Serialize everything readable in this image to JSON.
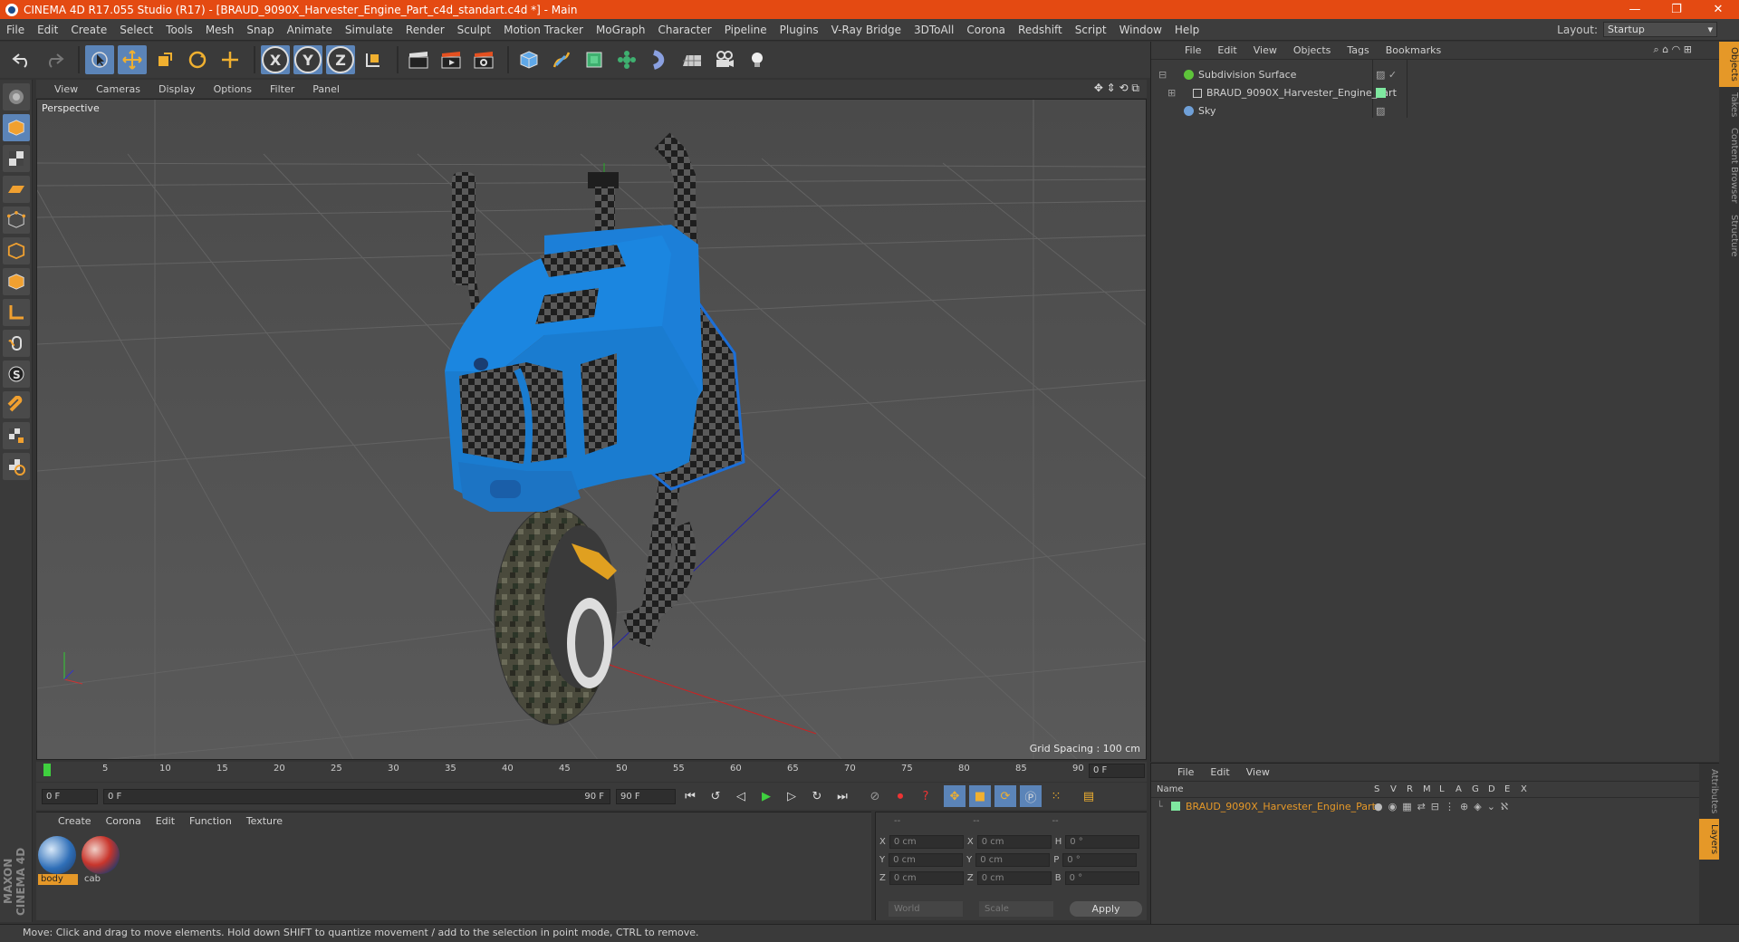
{
  "window": {
    "title": "CINEMA 4D R17.055 Studio (R17) - [BRAUD_9090X_Harvester_Engine_Part_c4d_standart.c4d *] - Main",
    "minimize": "—",
    "maximize": "❐",
    "close": "✕"
  },
  "menubar": {
    "items": [
      "File",
      "Edit",
      "Create",
      "Select",
      "Tools",
      "Mesh",
      "Snap",
      "Animate",
      "Simulate",
      "Render",
      "Sculpt",
      "Motion Tracker",
      "MoGraph",
      "Character",
      "Pipeline",
      "Plugins",
      "V-Ray Bridge",
      "3DToAll",
      "Corona",
      "Redshift",
      "Script",
      "Window",
      "Help"
    ],
    "layout_label": "Layout:",
    "layout_value": "Startup"
  },
  "toolbar": {
    "axis": [
      "X",
      "Y",
      "Z"
    ]
  },
  "viewport": {
    "menu": [
      "View",
      "Cameras",
      "Display",
      "Options",
      "Filter",
      "Panel"
    ],
    "label": "Perspective",
    "grid_spacing": "Grid Spacing : 100 cm"
  },
  "objects": {
    "menu": [
      "File",
      "Edit",
      "View",
      "Objects",
      "Tags",
      "Bookmarks"
    ],
    "items": [
      {
        "name": "Subdivision Surface",
        "color": "#5ec43a"
      },
      {
        "name": "BRAUD_9090X_Harvester_Engine_Part",
        "color": "#cfcfcf"
      },
      {
        "name": "Sky",
        "color": "#6fa0d8"
      }
    ]
  },
  "side_tabs": [
    "Objects",
    "Takes",
    "Content Browser",
    "Structure"
  ],
  "side_tabs_lower": [
    "Attributes",
    "Layers"
  ],
  "layers": {
    "menu": [
      "File",
      "Edit",
      "View"
    ],
    "header_name": "Name",
    "header_cols": [
      "S",
      "V",
      "R",
      "M",
      "L",
      "A",
      "G",
      "D",
      "E",
      "X"
    ],
    "row_name": "BRAUD_9090X_Harvester_Engine_Part",
    "row_color": "#e59828"
  },
  "timeline": {
    "ticks": [
      "0",
      "5",
      "10",
      "15",
      "20",
      "25",
      "30",
      "35",
      "40",
      "45",
      "50",
      "55",
      "60",
      "65",
      "70",
      "75",
      "80",
      "85",
      "90"
    ],
    "current": "0 F",
    "start": "0 F",
    "range_start": "0 F",
    "range_end": "90 F",
    "end": "90 F"
  },
  "materials": {
    "menu": [
      "Create",
      "Corona",
      "Edit",
      "Function",
      "Texture"
    ],
    "items": [
      {
        "name": "body",
        "color": "#2f6fb8"
      },
      {
        "name": "cab",
        "color": "#c8352c"
      }
    ]
  },
  "coordinates": {
    "headers": [
      "--",
      "--",
      "--"
    ],
    "rows": [
      {
        "a": "X",
        "av": "0 cm",
        "b": "X",
        "bv": "0 cm",
        "c": "H",
        "cv": "0 °"
      },
      {
        "a": "Y",
        "av": "0 cm",
        "b": "Y",
        "bv": "0 cm",
        "c": "P",
        "cv": "0 °"
      },
      {
        "a": "Z",
        "av": "0 cm",
        "b": "Z",
        "bv": "0 cm",
        "c": "B",
        "cv": "0 °"
      }
    ],
    "mode": "World",
    "type": "Scale",
    "apply": "Apply"
  },
  "status": "Move: Click and drag to move elements. Hold down SHIFT to quantize movement / add to the selection in point mode, CTRL to remove.",
  "branding": "MAXON CINEMA 4D"
}
